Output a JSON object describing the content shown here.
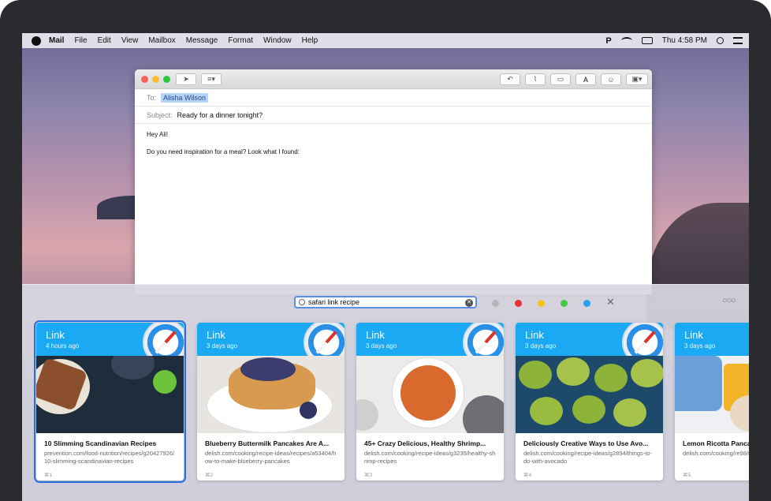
{
  "menubar": {
    "app": "Mail",
    "items": [
      "File",
      "Edit",
      "View",
      "Mailbox",
      "Message",
      "Format",
      "Window",
      "Help"
    ],
    "clock": "Thu 4:58 PM"
  },
  "mail": {
    "to_label": "To:",
    "to_value": "Alisha Wilson",
    "subject_label": "Subject:",
    "subject_value": "Ready for a dinner tonight?",
    "body_line1": "Hey Ali!",
    "body_line2": "Do you need inspiration for a meal? Look what I found:"
  },
  "shelf": {
    "search_value": "safari link recipe",
    "colors": [
      "#b5b5b8",
      "#e8303a",
      "#f6c21b",
      "#43c749",
      "#2a9df4"
    ],
    "cards": [
      {
        "kind": "Link",
        "age": "4 hours ago",
        "title": "10 Slimming Scandinavian Recipes",
        "url": "prevention.com/food-nutrition/recipes/g20427926/10-slimming-scandinavian-recipes",
        "shortcut": "⌘1"
      },
      {
        "kind": "Link",
        "age": "3 days ago",
        "title": "Blueberry Buttermilk Pancakes Are A...",
        "url": "delish.com/cooking/recipe-ideas/recipes/a53404/how-to-make-blueberry-pancakes",
        "shortcut": "⌘2"
      },
      {
        "kind": "Link",
        "age": "3 days ago",
        "title": "45+ Crazy Delicious, Healthy Shrimp...",
        "url": "delish.com/cooking/recipe-ideas/g3235/healthy-shrimp-recipes",
        "shortcut": "⌘3"
      },
      {
        "kind": "Link",
        "age": "3 days ago",
        "title": "Deliciously Creative Ways to Use Avo...",
        "url": "delish.com/cooking/recipe-ideas/g2894/things-to-do-with-avocado",
        "shortcut": "⌘4"
      },
      {
        "kind": "Link",
        "age": "3 days ago",
        "title": "Lemon Ricotta Panca",
        "url": "delish.com/cooking/re98/ricotta-pancakes-r",
        "shortcut": "⌘5"
      }
    ]
  }
}
